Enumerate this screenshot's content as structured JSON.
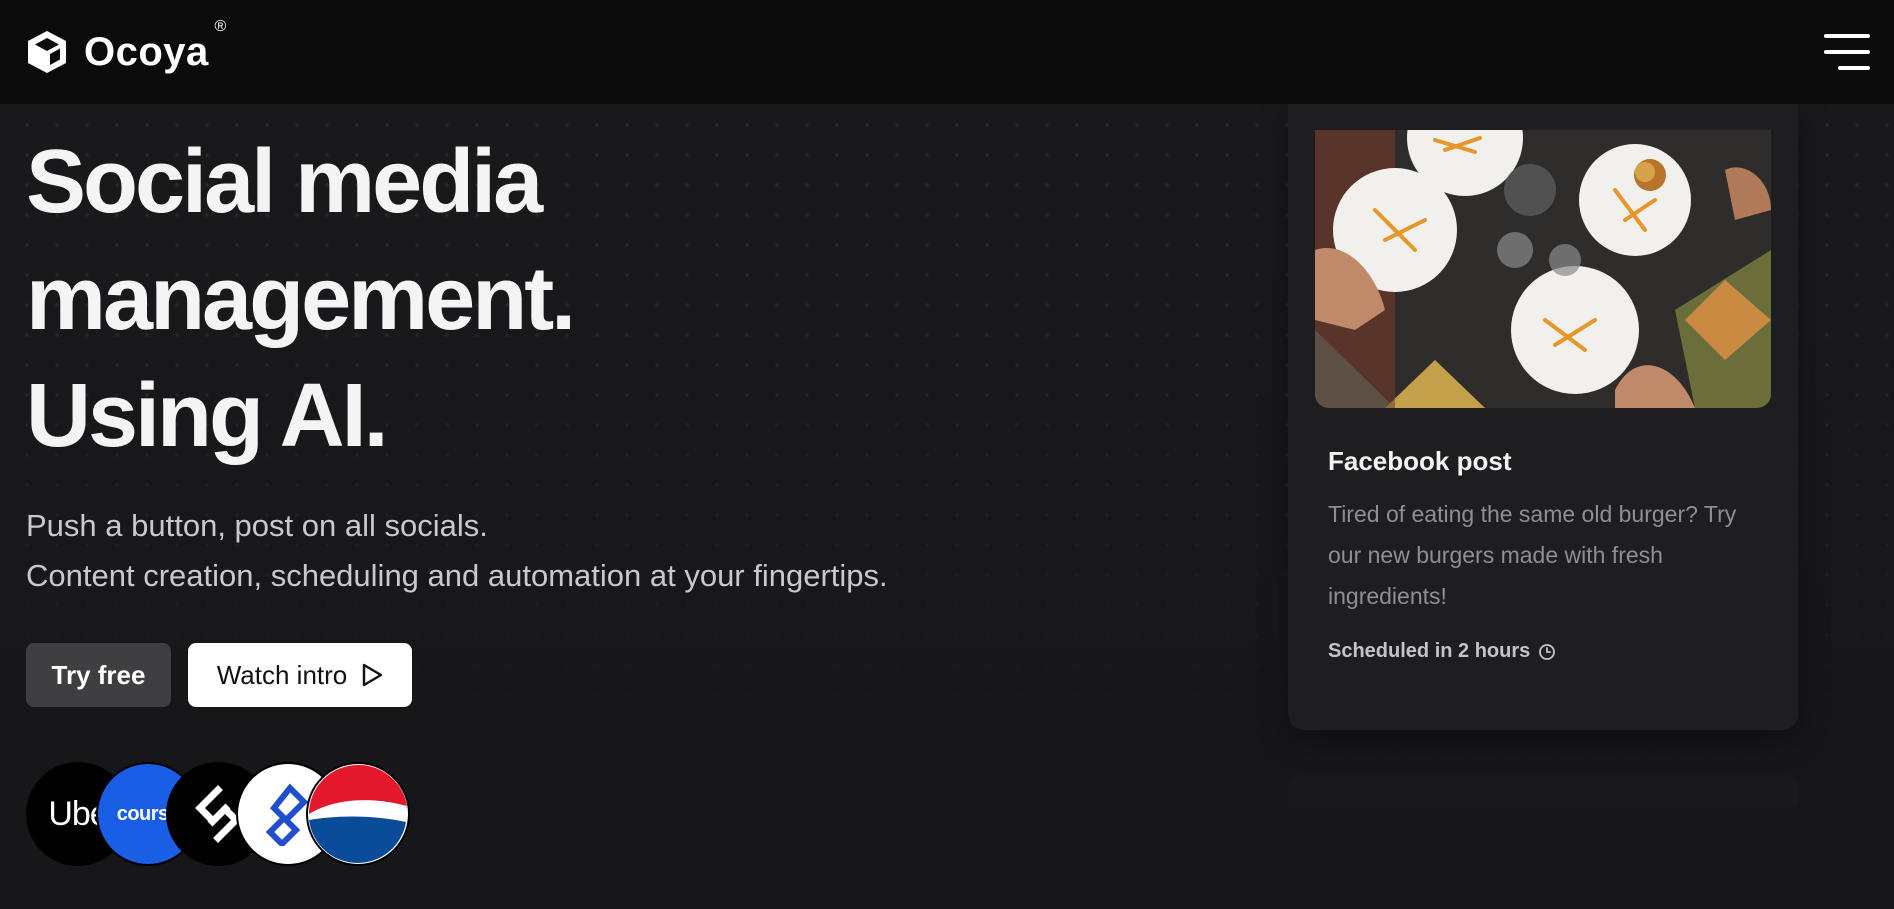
{
  "header": {
    "brand": "Ocoya",
    "registered_mark": "®",
    "menu_icon": "hamburger-menu-icon"
  },
  "hero": {
    "headline_line1": "Social media",
    "headline_line2": "management.",
    "headline_line3": "Using AI.",
    "subline_line1": "Push a button, post on all socials.",
    "subline_line2": "Content creation, scheduling and automation at your fingertips.",
    "try_free_label": "Try free",
    "watch_intro_label": "Watch intro"
  },
  "client_logos": {
    "uber": "Ube",
    "coursera": "course",
    "items": [
      "uber-logo",
      "coursera-logo",
      "squarespace-style-logo",
      "toptal-logo",
      "pepsi-logo"
    ]
  },
  "post_card": {
    "title": "Facebook post",
    "body": "Tired of eating the same old burger? Try our new burgers made with fresh ingredients!",
    "status": "Scheduled in 2 hours",
    "status_icon": "clock-icon"
  },
  "colors": {
    "background": "#17171a",
    "header": "#0b0b0c",
    "try_button": "#3f3f42",
    "watch_button": "#ffffff",
    "coursera_blue": "#1b5ee6",
    "pepsi_red": "#e3182d",
    "pepsi_blue": "#0a4c9a"
  }
}
